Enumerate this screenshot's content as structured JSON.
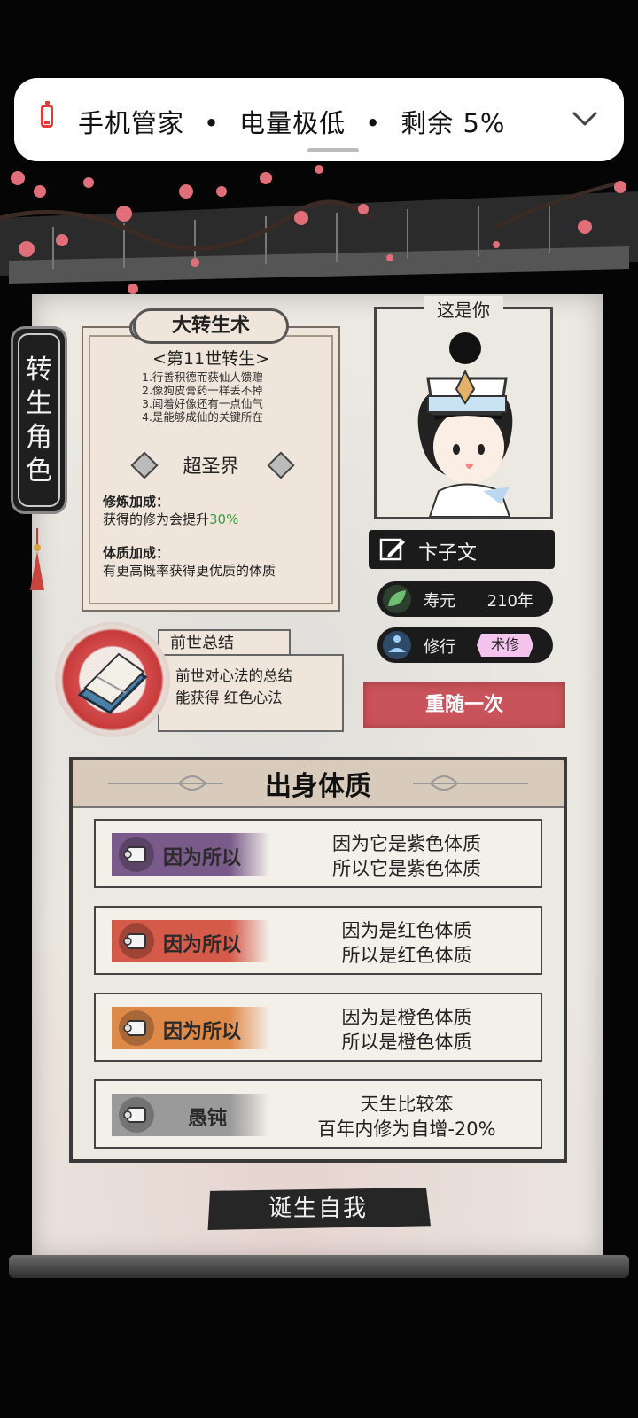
{
  "notification": {
    "app": "手机管家",
    "message": "电量极低",
    "remaining": "剩余 5%",
    "separator": "•"
  },
  "side_tag": {
    "label": "转生角色"
  },
  "rebirth": {
    "title": "大转生术",
    "subtitle": "<第11世转生>",
    "lines": [
      "1.行善积德而获仙人馈赠",
      "2.像狗皮膏药一样丢不掉",
      "3.闻着好像还有一点仙气",
      "4.是能够成仙的关键所在"
    ],
    "realm": "超圣界",
    "bonus1_title": "修炼加成：",
    "bonus1_text": "获得的修为会提升",
    "bonus1_value": "30%",
    "bonus2_title": "体质加成：",
    "bonus2_text": "有更高概率获得更优质的体质"
  },
  "past_life": {
    "tab": "前世总结",
    "line1": "前世对心法的总结",
    "line2": "能获得 红色心法"
  },
  "portrait": {
    "caption": "这是你"
  },
  "character": {
    "name": "卞子文",
    "lifespan_label": "寿元",
    "lifespan_value": "210年",
    "cultivation_label": "修行",
    "cultivation_value": "术修",
    "reroll": "重随一次"
  },
  "traits": {
    "title": "出身体质",
    "items": [
      {
        "label": "因为所以",
        "line1": "因为它是紫色体质",
        "line2": "所以它是紫色体质",
        "color": "#7a5a8a",
        "icon": "scroll-icon"
      },
      {
        "label": "因为所以",
        "line1": "因为是红色体质",
        "line2": "所以是红色体质",
        "color": "#d65a4a",
        "icon": "fist-icon"
      },
      {
        "label": "因为所以",
        "line1": "因为是橙色体质",
        "line2": "所以是橙色体质",
        "color": "#e08a4a",
        "icon": "scroll-icon"
      },
      {
        "label": "愚钝",
        "line1": "天生比较笨",
        "line2": "百年内修为自增-20%",
        "color": "#9a9a9a",
        "icon": "scroll-icon"
      }
    ]
  },
  "confirm_button": "诞生自我"
}
